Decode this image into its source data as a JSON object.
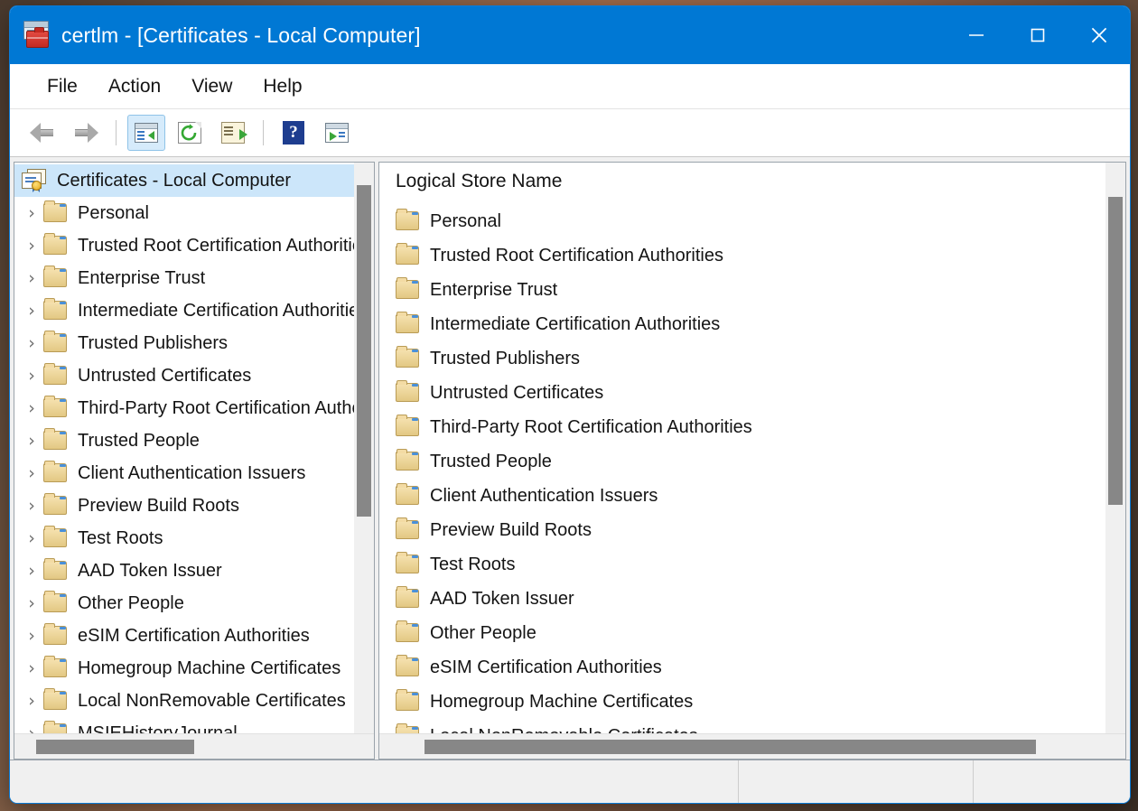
{
  "window": {
    "title": "certlm - [Certificates - Local Computer]",
    "app_icon": "certlm-console-icon",
    "accent_color": "#0078d4",
    "border_color": "#0a7bd6",
    "controls": {
      "minimize": "minimize-button",
      "maximize": "maximize-button",
      "close": "close-button"
    }
  },
  "menubar": {
    "items": [
      {
        "label": "File",
        "name": "menu-file"
      },
      {
        "label": "Action",
        "name": "menu-action"
      },
      {
        "label": "View",
        "name": "menu-view"
      },
      {
        "label": "Help",
        "name": "menu-help"
      }
    ]
  },
  "toolbar": {
    "buttons": [
      {
        "name": "back-button",
        "icon": "arrow-left-icon",
        "tooltip": "Back",
        "active": false
      },
      {
        "name": "forward-button",
        "icon": "arrow-right-icon",
        "tooltip": "Forward",
        "active": false
      },
      {
        "name": "show-hide-console-tree-button",
        "icon": "console-tree-icon",
        "tooltip": "Show/Hide Console Tree",
        "active": true
      },
      {
        "name": "refresh-button",
        "icon": "refresh-icon",
        "tooltip": "Refresh",
        "active": false
      },
      {
        "name": "export-list-button",
        "icon": "export-list-icon",
        "tooltip": "Export List",
        "active": false
      },
      {
        "name": "help-button",
        "icon": "help-question-icon",
        "tooltip": "Help",
        "active": false
      },
      {
        "name": "show-hide-action-pane-button",
        "icon": "action-pane-icon",
        "tooltip": "Show/Hide Action Pane",
        "active": false
      }
    ]
  },
  "tree": {
    "root": {
      "label": "Certificates - Local Computer",
      "icon": "certificate-icon",
      "selected": true,
      "expanded": true
    },
    "nodes": [
      {
        "label": "Personal",
        "icon": "folder-icon",
        "expandable": true
      },
      {
        "label": "Trusted Root Certification Authorities",
        "icon": "folder-icon",
        "expandable": true
      },
      {
        "label": "Enterprise Trust",
        "icon": "folder-icon",
        "expandable": true
      },
      {
        "label": "Intermediate Certification Authorities",
        "icon": "folder-icon",
        "expandable": true
      },
      {
        "label": "Trusted Publishers",
        "icon": "folder-icon",
        "expandable": true
      },
      {
        "label": "Untrusted Certificates",
        "icon": "folder-icon",
        "expandable": true
      },
      {
        "label": "Third-Party Root Certification Authorities",
        "icon": "folder-icon",
        "expandable": true
      },
      {
        "label": "Trusted People",
        "icon": "folder-icon",
        "expandable": true
      },
      {
        "label": "Client Authentication Issuers",
        "icon": "folder-icon",
        "expandable": true
      },
      {
        "label": "Preview Build Roots",
        "icon": "folder-icon",
        "expandable": true
      },
      {
        "label": "Test Roots",
        "icon": "folder-icon",
        "expandable": true
      },
      {
        "label": "AAD Token Issuer",
        "icon": "folder-icon",
        "expandable": true
      },
      {
        "label": "Other People",
        "icon": "folder-icon",
        "expandable": true
      },
      {
        "label": "eSIM Certification Authorities",
        "icon": "folder-icon",
        "expandable": true
      },
      {
        "label": "Homegroup Machine Certificates",
        "icon": "folder-icon",
        "expandable": true
      },
      {
        "label": "Local NonRemovable Certificates",
        "icon": "folder-icon",
        "expandable": true
      },
      {
        "label": "MSIEHistoryJournal",
        "icon": "folder-icon",
        "expandable": true
      }
    ],
    "chevron_glyph": "›",
    "scrollbar": {
      "thumb_top_pct": 4,
      "thumb_height_pct": 58
    },
    "hscrollbar": {
      "thumb_left_pct": 6,
      "thumb_width_pct": 44
    }
  },
  "list": {
    "column_header": "Logical Store Name",
    "rows": [
      {
        "label": "Personal",
        "icon": "folder-icon"
      },
      {
        "label": "Trusted Root Certification Authorities",
        "icon": "folder-icon"
      },
      {
        "label": "Enterprise Trust",
        "icon": "folder-icon"
      },
      {
        "label": "Intermediate Certification Authorities",
        "icon": "folder-icon"
      },
      {
        "label": "Trusted Publishers",
        "icon": "folder-icon"
      },
      {
        "label": "Untrusted Certificates",
        "icon": "folder-icon"
      },
      {
        "label": "Third-Party Root Certification Authorities",
        "icon": "folder-icon"
      },
      {
        "label": "Trusted People",
        "icon": "folder-icon"
      },
      {
        "label": "Client Authentication Issuers",
        "icon": "folder-icon"
      },
      {
        "label": "Preview Build Roots",
        "icon": "folder-icon"
      },
      {
        "label": "Test Roots",
        "icon": "folder-icon"
      },
      {
        "label": "AAD Token Issuer",
        "icon": "folder-icon"
      },
      {
        "label": "Other People",
        "icon": "folder-icon"
      },
      {
        "label": "eSIM Certification Authorities",
        "icon": "folder-icon"
      },
      {
        "label": "Homegroup Machine Certificates",
        "icon": "folder-icon"
      },
      {
        "label": "Local NonRemovable Certificates",
        "icon": "folder-icon"
      }
    ],
    "scrollbar": {
      "thumb_top_pct": 6,
      "thumb_height_pct": 54
    },
    "hscrollbar": {
      "thumb_left_pct": 6,
      "thumb_width_pct": 82
    }
  },
  "statusbar": {
    "main": "",
    "cell_b": "",
    "cell_c": ""
  }
}
